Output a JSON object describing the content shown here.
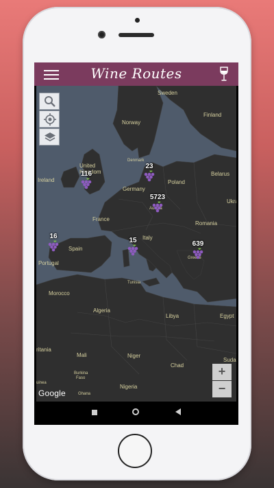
{
  "app": {
    "title": "Wine Routes",
    "bar_color": "#7b3b5e"
  },
  "icons": {
    "menu": "hamburger-menu-icon",
    "wine": "wine-glass-icon",
    "search": "search-icon",
    "locate": "locate-icon",
    "layers": "layers-icon",
    "grapes": "grapes-icon"
  },
  "map": {
    "labels": {
      "sweden": "Sweden",
      "finland": "Finland",
      "norway": "Norway",
      "united": "United",
      "kingdom": "Kingdom",
      "ireland": "Ireland",
      "denmark": "Denmark",
      "belarus": "Belarus",
      "poland": "Poland",
      "germany": "Germany",
      "ukraine": "Ukra",
      "france": "France",
      "austria": "Austria",
      "romania": "Romania",
      "italy": "Italy",
      "spain": "Spain",
      "portugal": "Portugal",
      "greece": "Greece",
      "tunisia": "Tunisia",
      "morocco": "Morocco",
      "algeria": "Algeria",
      "libya": "Libya",
      "egypt": "Egypt",
      "mauritania": "ritania",
      "mali": "Mali",
      "niger": "Niger",
      "chad": "Chad",
      "sudan": "Suda",
      "burkina": "Burkina",
      "faso": "Faso",
      "guinea": "uinea",
      "ghana": "Ghana",
      "nigeria": "Nigeria"
    },
    "clusters": [
      {
        "count": "116",
        "region": "United Kingdom"
      },
      {
        "count": "23",
        "region": "Denmark"
      },
      {
        "count": "5723",
        "region": "Austria"
      },
      {
        "count": "16",
        "region": "Portugal"
      },
      {
        "count": "15",
        "region": "Italy"
      },
      {
        "count": "639",
        "region": "Greece"
      }
    ],
    "zoom_in": "+",
    "zoom_out": "−",
    "attribution": "Google"
  }
}
